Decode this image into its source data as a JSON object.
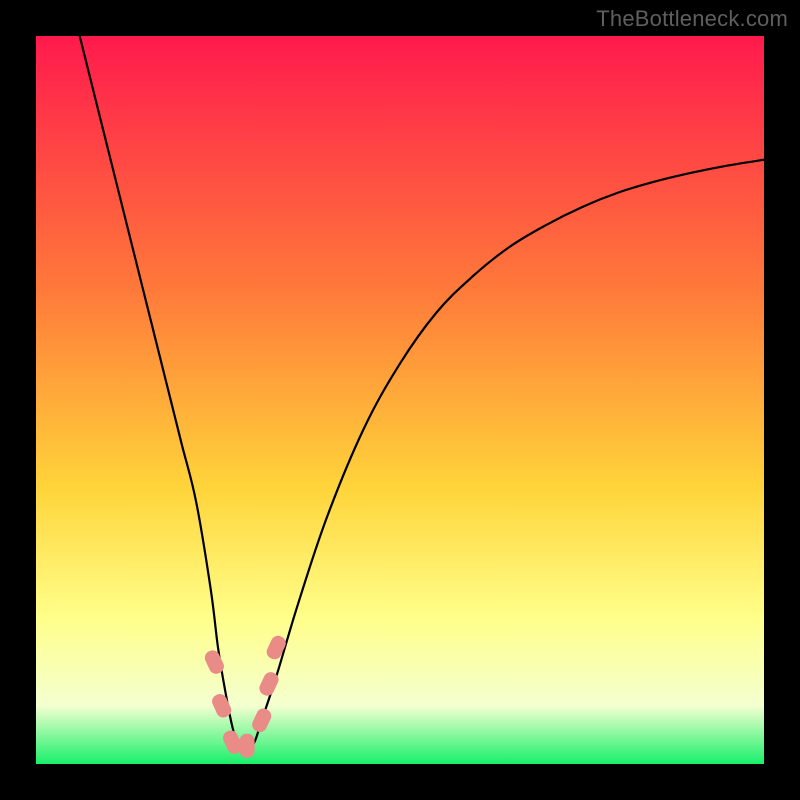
{
  "watermark": "TheBottleneck.com",
  "colors": {
    "frame": "#000000",
    "gradient_top": "#ff1a4d",
    "gradient_mid1": "#ff7a3a",
    "gradient_mid2": "#ffd43a",
    "gradient_mid3": "#ffff8a",
    "gradient_mid4": "#f4ffd0",
    "gradient_bottom": "#18f06a",
    "curve": "#000000",
    "marker": "#e98b87"
  },
  "chart_data": {
    "type": "line",
    "title": "",
    "xlabel": "",
    "ylabel": "",
    "xlim": [
      0,
      100
    ],
    "ylim": [
      0,
      100
    ],
    "grid": false,
    "legend": false,
    "series": [
      {
        "name": "bottleneck-curve",
        "x": [
          6,
          8,
          10,
          12,
          14,
          16,
          18,
          20,
          22,
          24,
          25,
          26,
          27,
          28,
          29,
          30,
          31,
          33,
          36,
          40,
          45,
          50,
          55,
          60,
          65,
          70,
          75,
          80,
          85,
          90,
          95,
          100
        ],
        "y": [
          100,
          92,
          84,
          76,
          68,
          60,
          52,
          44,
          36,
          24,
          16,
          10,
          5,
          2,
          2,
          3,
          6,
          12,
          22,
          34,
          46,
          55,
          62,
          67,
          71,
          74,
          76.5,
          78.5,
          80,
          81.2,
          82.2,
          83
        ]
      }
    ],
    "markers": [
      {
        "x": 24.5,
        "y": 14
      },
      {
        "x": 25.5,
        "y": 8
      },
      {
        "x": 27.0,
        "y": 3
      },
      {
        "x": 29.0,
        "y": 2.5
      },
      {
        "x": 31.0,
        "y": 6
      },
      {
        "x": 32.0,
        "y": 11
      },
      {
        "x": 33.0,
        "y": 16
      }
    ],
    "annotations": []
  }
}
